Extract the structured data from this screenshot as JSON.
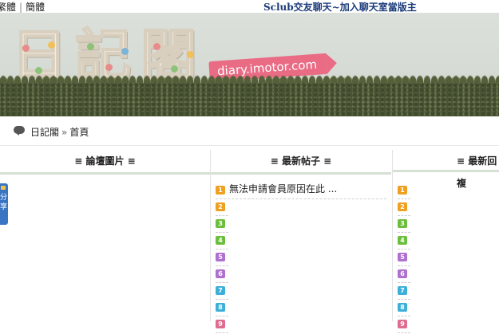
{
  "topbar": {
    "lang_traditional": "繁體",
    "lang_separator": "|",
    "lang_simplified": "簡體",
    "promo": "Sclub交友聊天~加入聊天室當版主"
  },
  "banner": {
    "logo_chars": [
      "日",
      "記",
      "閣"
    ],
    "tag": "diary.imotor.com"
  },
  "breadcrumb": {
    "home": "日記閣",
    "arrow": "»",
    "current": "首頁"
  },
  "columns": {
    "col1": "≡ 論壇圖片 ≡",
    "col2": "≡ 最新帖子 ≡",
    "col3": "≡ 最新回複"
  },
  "share": {
    "label_line1": "分",
    "label_line2": "享"
  },
  "latest_posts": [
    {
      "num": "1",
      "title": "無法申請會員原因在此 ..."
    },
    {
      "num": "2",
      "title": ""
    },
    {
      "num": "3",
      "title": ""
    },
    {
      "num": "4",
      "title": ""
    },
    {
      "num": "5",
      "title": ""
    },
    {
      "num": "6",
      "title": ""
    },
    {
      "num": "7",
      "title": ""
    },
    {
      "num": "8",
      "title": ""
    },
    {
      "num": "9",
      "title": ""
    }
  ],
  "latest_replies": [
    {
      "num": "1"
    },
    {
      "num": "2"
    },
    {
      "num": "3"
    },
    {
      "num": "4"
    },
    {
      "num": "5"
    },
    {
      "num": "6"
    },
    {
      "num": "7"
    },
    {
      "num": "8"
    },
    {
      "num": "9"
    }
  ],
  "badge_colors": [
    "#f0a020",
    "#f0a020",
    "#6cbf3c",
    "#6cbf3c",
    "#b070d0",
    "#b070d0",
    "#3cb0d8",
    "#3cb0d8",
    "#e06c90"
  ]
}
